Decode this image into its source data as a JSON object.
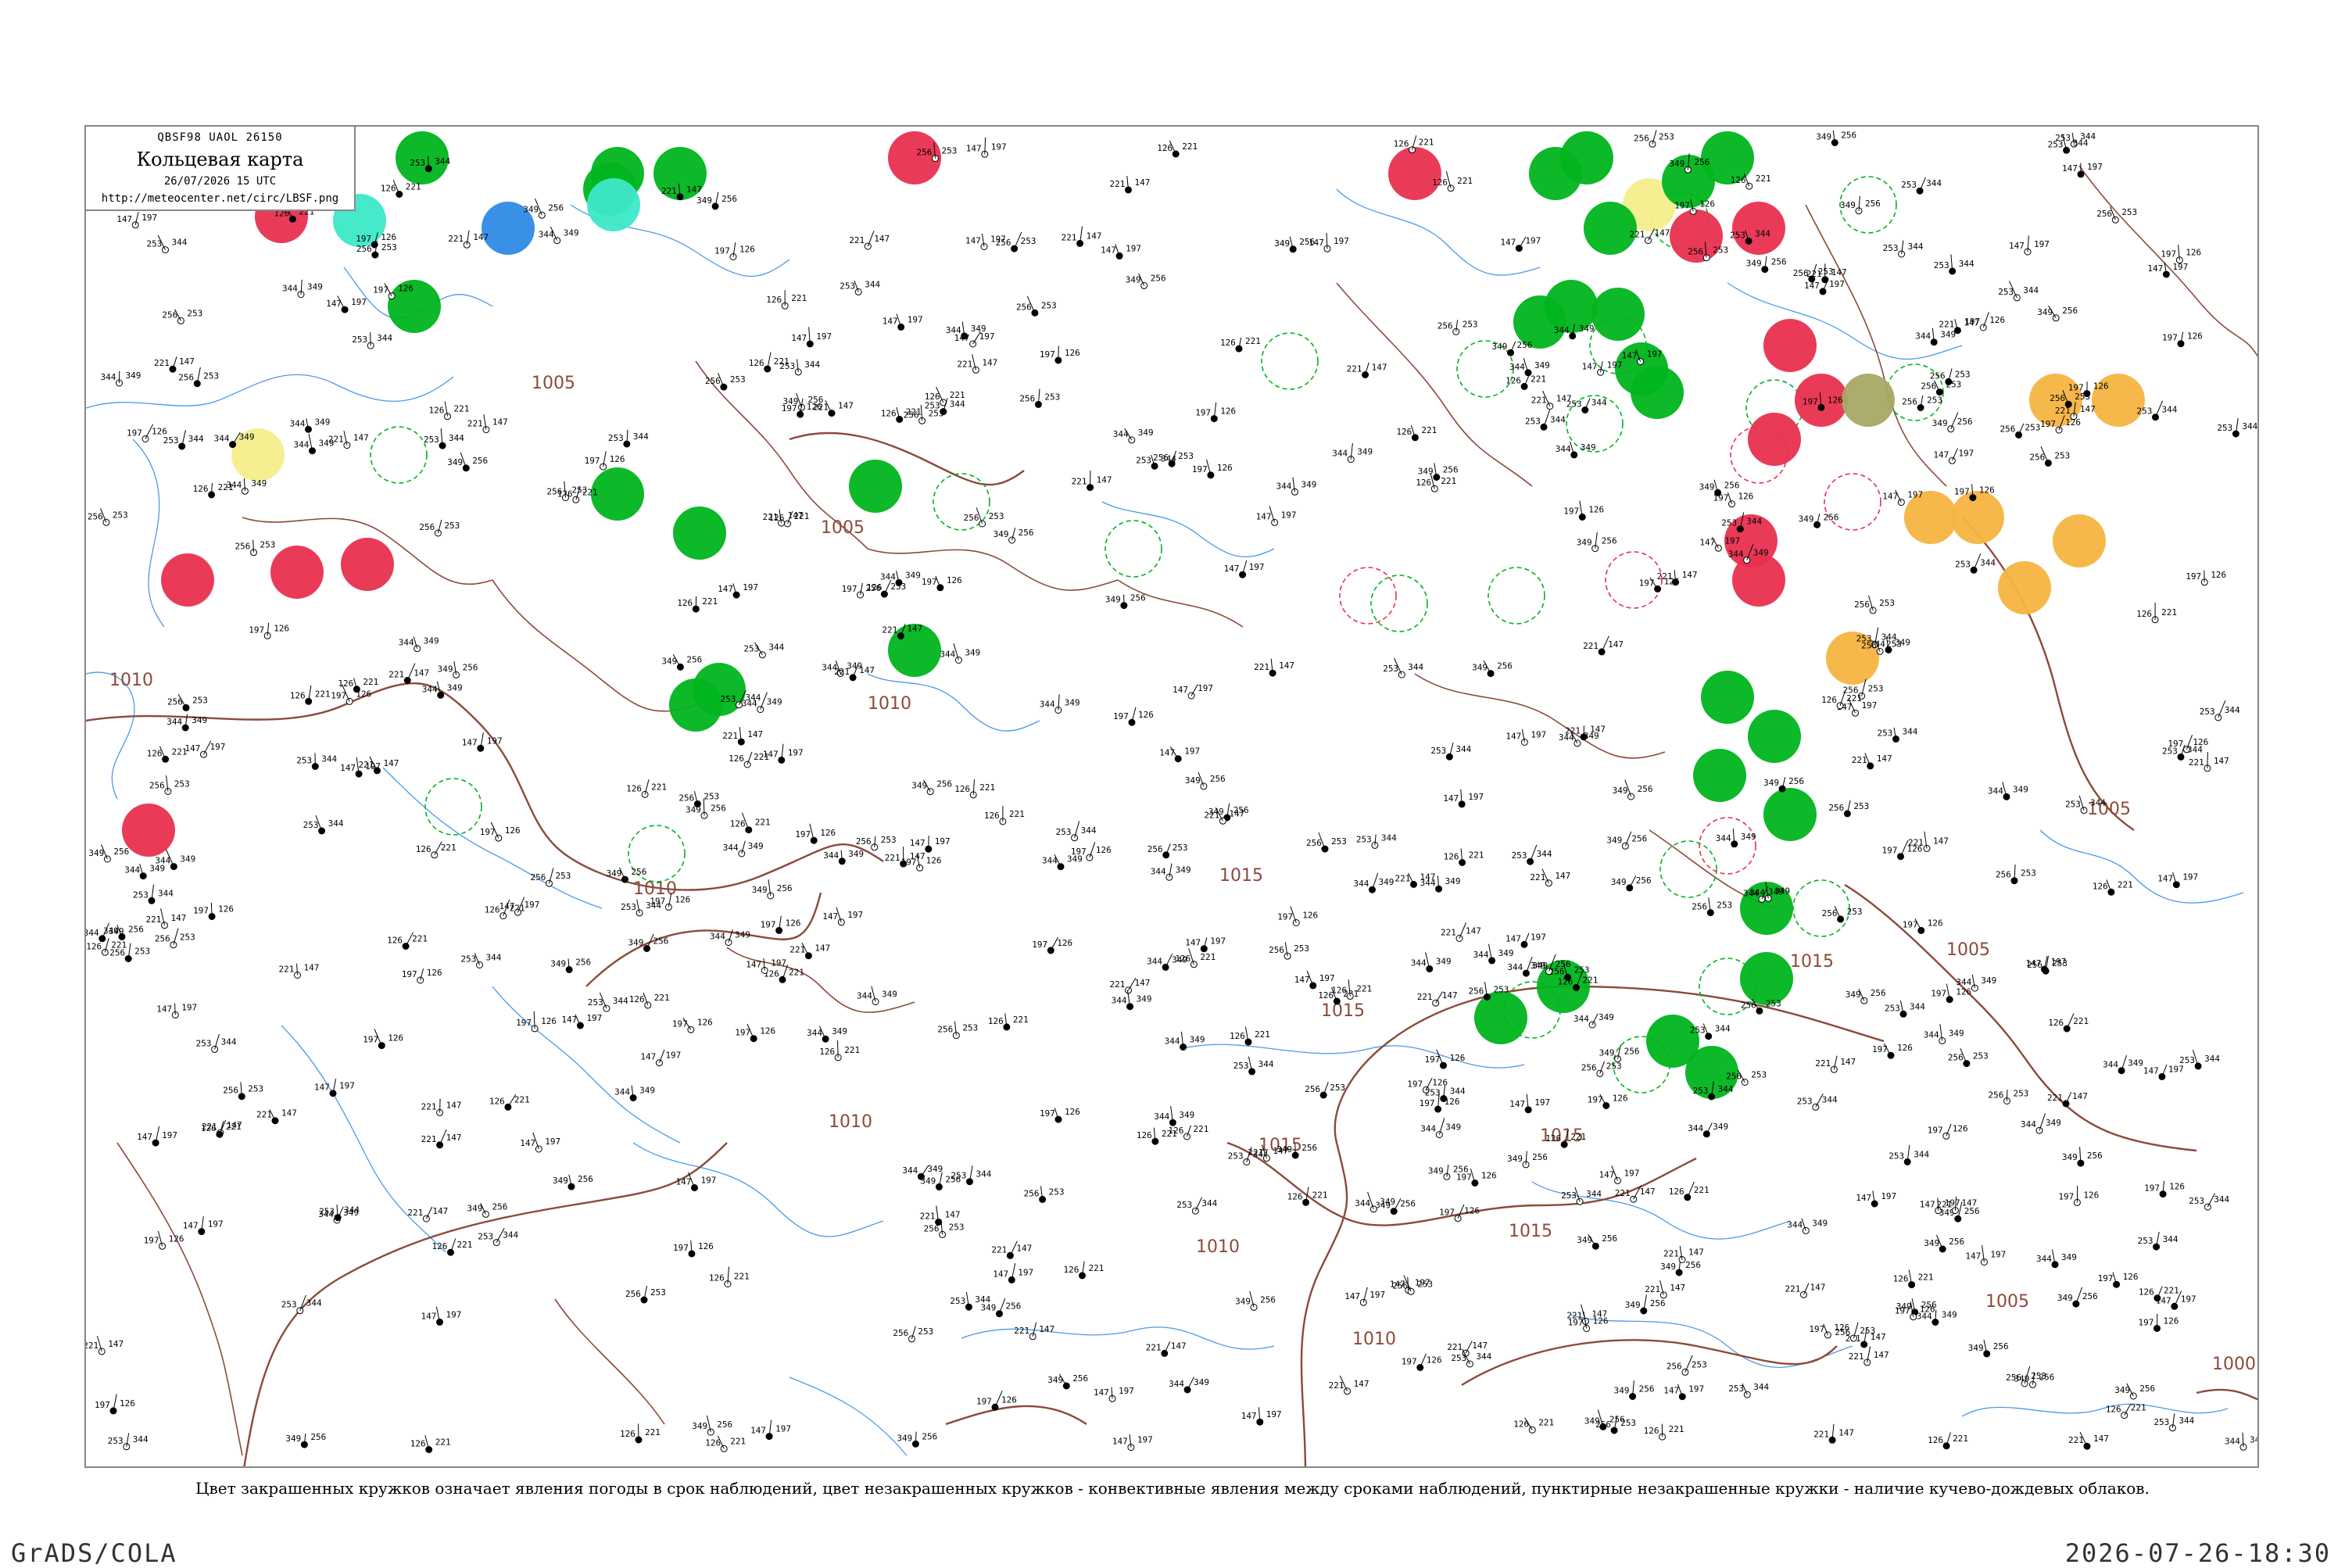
{
  "header": {
    "codes": "QBSF98  UAOL  26150",
    "title": "Кольцевая карта",
    "datetime": "26/07/2026 15 UTC",
    "url": "http://meteocenter.net/circ/LBSF.png"
  },
  "legend_note": "Цвет закрашенных кружков означает явления погоды в срок наблюдений, цвет незакрашенных кружков - конвективные явления между сроками наблюдений, пунктирные незакрашенные кружки - наличие кучево-дождевых облаков.",
  "footer": {
    "left": "GrADS/COLA",
    "right": "2026-07-26-18:30"
  },
  "isobar_labels": [
    "1005",
    "1005",
    "1010",
    "1010",
    "1010",
    "1010",
    "1015",
    "1015",
    "1015",
    "1015",
    "1015",
    "1015",
    "1010",
    "1010",
    "1005",
    "1005",
    "1005",
    "1000"
  ],
  "colors": {
    "thunderstorm": "#e8304f",
    "rain": "#00b41e",
    "drizzle_shower": "#f5ee8c",
    "fog": "#f5b441",
    "snow": "#2f8ae6",
    "haze": "#3de8c8",
    "dust": "#a8a864",
    "coast": "#4a9ae8",
    "border": "#8b4a3a",
    "isobar": "#8b4a3a"
  },
  "sample_station_values": [
    "221",
    "147",
    "256",
    "349",
    "197",
    "126",
    "344",
    "253"
  ]
}
